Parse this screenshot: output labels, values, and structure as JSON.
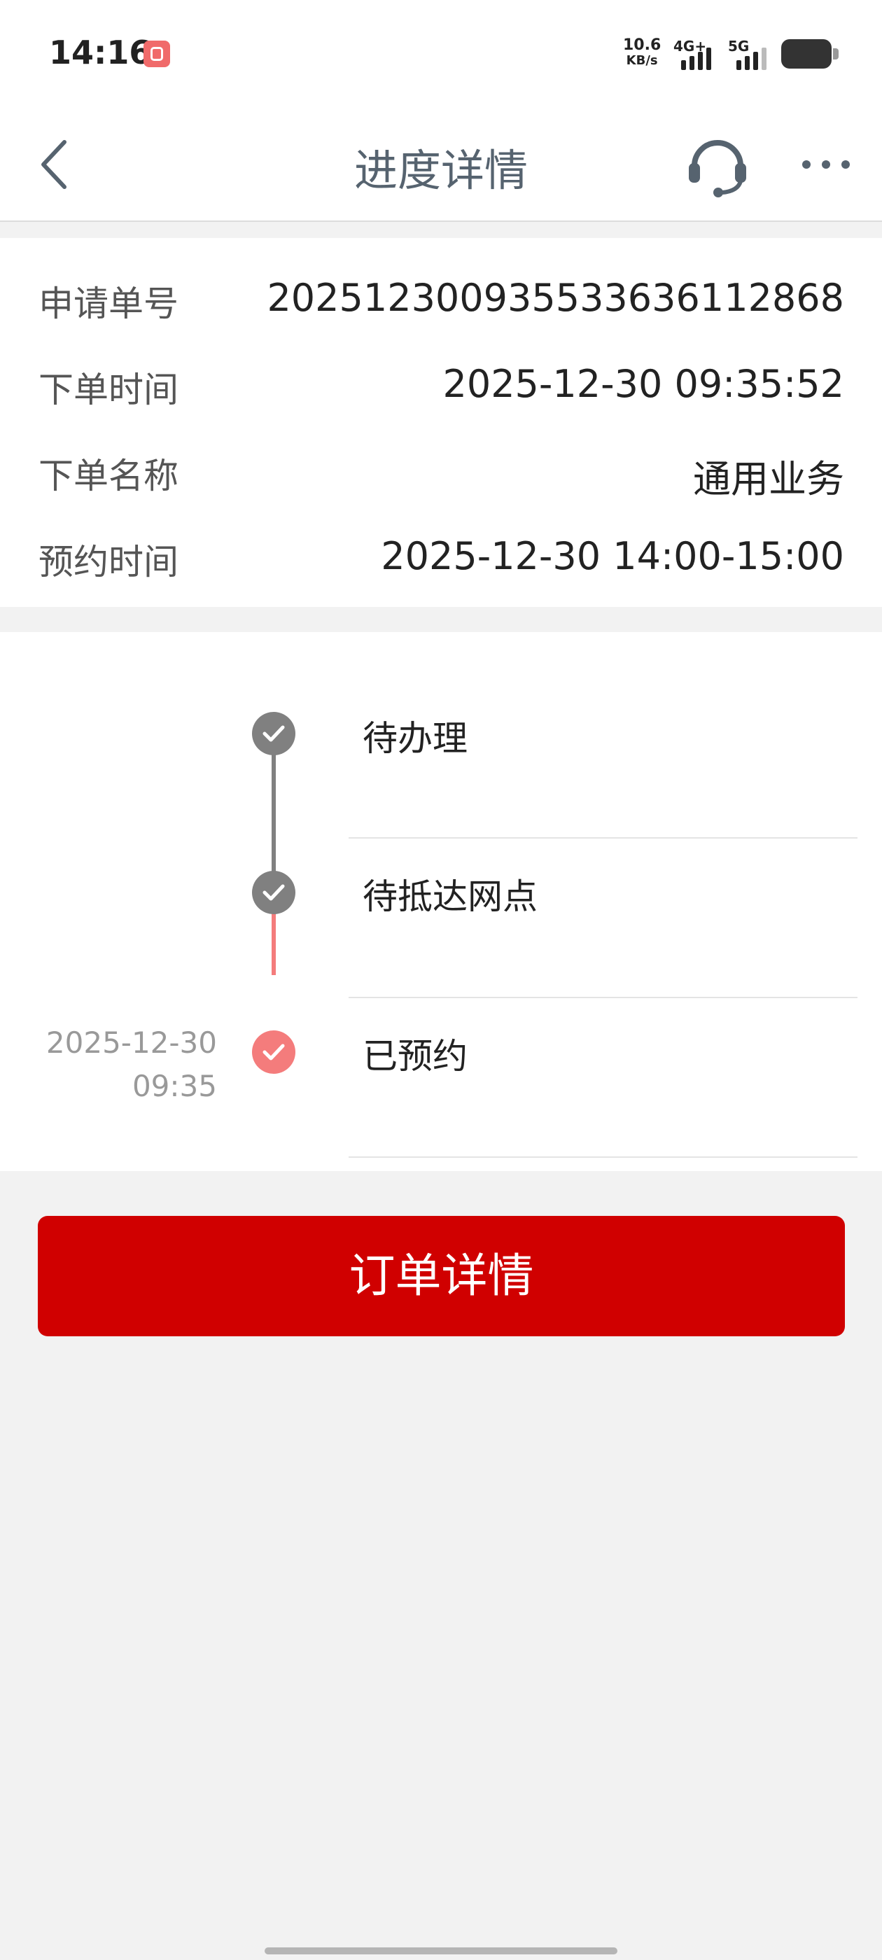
{
  "status_bar": {
    "time": "14:16",
    "net_speed_value": "10.6",
    "net_speed_unit": "KB/s",
    "network_1": "4G+",
    "network_2": "5G"
  },
  "nav": {
    "title": "进度详情",
    "back_icon": "chevron-left-icon",
    "service_icon": "headset-icon",
    "more_icon": "more-dots-icon"
  },
  "info": [
    {
      "label": "申请单号",
      "value": "2025123009355336361128​68"
    },
    {
      "label": "下单时间",
      "value": "2025-12-30 09:35:52"
    },
    {
      "label": "下单名称",
      "value": "通用业务"
    },
    {
      "label": "预约时间",
      "value": "2025-12-30 14:00-15:00"
    }
  ],
  "timeline": {
    "steps": [
      {
        "label": "待办理",
        "status": "done",
        "date": "",
        "time": ""
      },
      {
        "label": "待抵达网点",
        "status": "done",
        "date": "",
        "time": ""
      },
      {
        "label": "已预约",
        "status": "current",
        "date": "2025-12-30",
        "time": "09:35"
      }
    ],
    "colors": {
      "done": "#808080",
      "current": "#f47c7c"
    }
  },
  "order_button": {
    "label": "订单详情",
    "color": "#d00000"
  }
}
